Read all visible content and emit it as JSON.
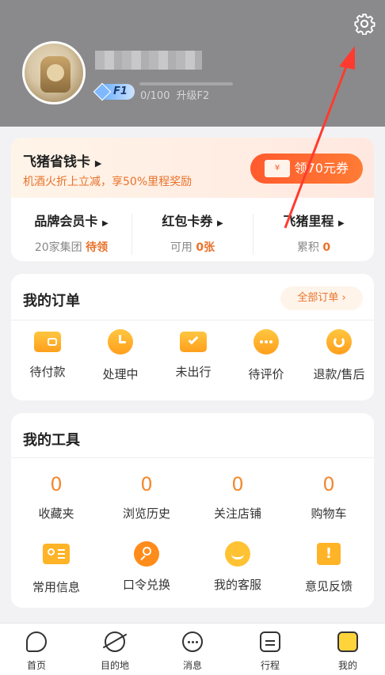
{
  "header": {
    "level": "F1",
    "progress_text": "0/100",
    "progress_fraction": 0,
    "upgrade_text": "升级F2"
  },
  "vip": {
    "title": "飞猪省钱卡",
    "subtitle": "机酒火折上立减，享50%里程奖励",
    "coupon_button": "领70元券",
    "coupon_ticket": "¥"
  },
  "stats": [
    {
      "title": "品牌会员卡",
      "prefix": "20家集团",
      "value": "待领"
    },
    {
      "title": "红包卡券",
      "prefix": "可用",
      "value": "0张"
    },
    {
      "title": "飞猪里程",
      "prefix": "累积",
      "value": "0"
    }
  ],
  "orders": {
    "title": "我的订单",
    "all_label": "全部订单",
    "items": [
      {
        "label": "待付款",
        "icon": "wallet-icon"
      },
      {
        "label": "处理中",
        "icon": "clock-icon"
      },
      {
        "label": "未出行",
        "icon": "calendar-check-icon"
      },
      {
        "label": "待评价",
        "icon": "chat-bubble-icon"
      },
      {
        "label": "退款/售后",
        "icon": "refund-icon"
      }
    ]
  },
  "tools": {
    "title": "我的工具",
    "counts": [
      {
        "value": "0",
        "label": "收藏夹"
      },
      {
        "value": "0",
        "label": "浏览历史"
      },
      {
        "value": "0",
        "label": "关注店铺"
      },
      {
        "value": "0",
        "label": "购物车"
      }
    ],
    "items": [
      {
        "label": "常用信息",
        "icon": "id-card-icon"
      },
      {
        "label": "口令兑换",
        "icon": "key-search-icon"
      },
      {
        "label": "我的客服",
        "icon": "customer-service-icon"
      },
      {
        "label": "意见反馈",
        "icon": "feedback-icon"
      }
    ]
  },
  "tabbar": [
    {
      "label": "首页"
    },
    {
      "label": "目的地"
    },
    {
      "label": "消息"
    },
    {
      "label": "行程"
    },
    {
      "label": "我的"
    }
  ],
  "colors": {
    "accent": "#e8722a",
    "coupon": "#ff5a2e",
    "header_bg": "#8a8a8c",
    "annotation_arrow": "#ff3b2f"
  }
}
